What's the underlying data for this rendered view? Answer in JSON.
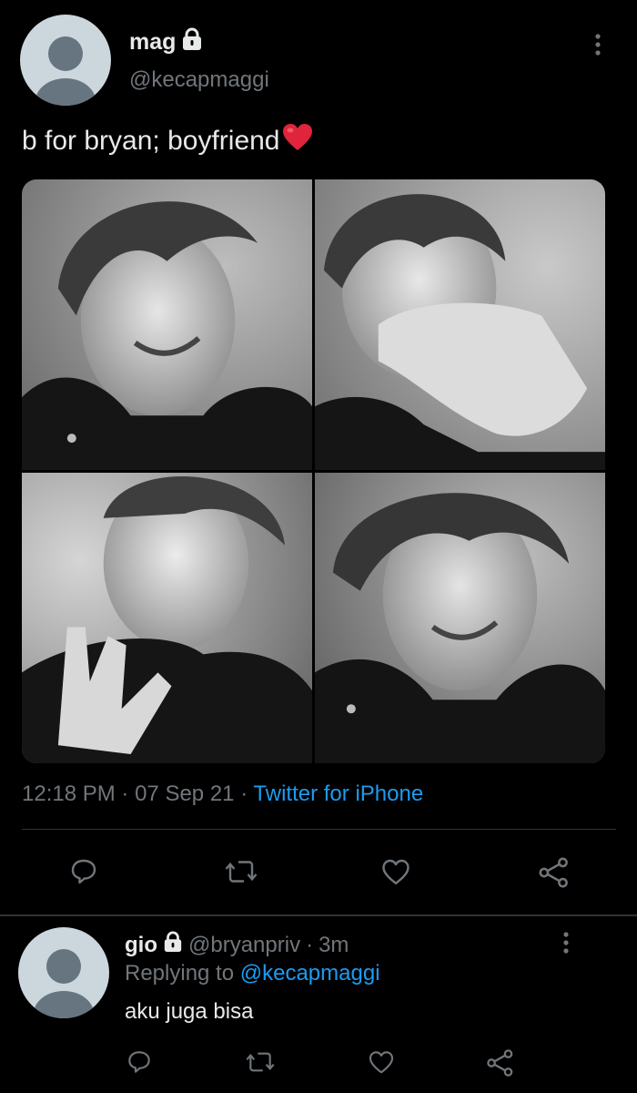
{
  "tweet": {
    "author_name": "mag",
    "author_handle": "@kecapmaggi",
    "text": "b for bryan; boyfriend",
    "emoji": "❤️",
    "time": "12:18 PM",
    "date": "07 Sep 21",
    "source": "Twitter for iPhone",
    "separator": "·",
    "photos": [
      {
        "name": "photo-1",
        "description": "smiling"
      },
      {
        "name": "photo-2",
        "description": "hand-over-mouth"
      },
      {
        "name": "photo-3",
        "description": "hand-gesture"
      },
      {
        "name": "photo-4",
        "description": "smiling"
      }
    ]
  },
  "reply": {
    "author_name": "gio",
    "author_handle": "@bryanpriv",
    "age": "3m",
    "replying_label": "Replying to",
    "replying_to": "@kecapmaggi",
    "text": "aku juga bisa"
  },
  "icons": {
    "lock": "lock-icon",
    "more": "more-vertical-icon",
    "reply": "reply-icon",
    "retweet": "retweet-icon",
    "like": "heart-icon",
    "share": "share-icon"
  },
  "colors": {
    "background": "#000000",
    "text": "#e7e9ea",
    "secondary": "#71767b",
    "accent": "#1d9bf0",
    "divider": "#2f3336",
    "heart": "#e0243b"
  }
}
